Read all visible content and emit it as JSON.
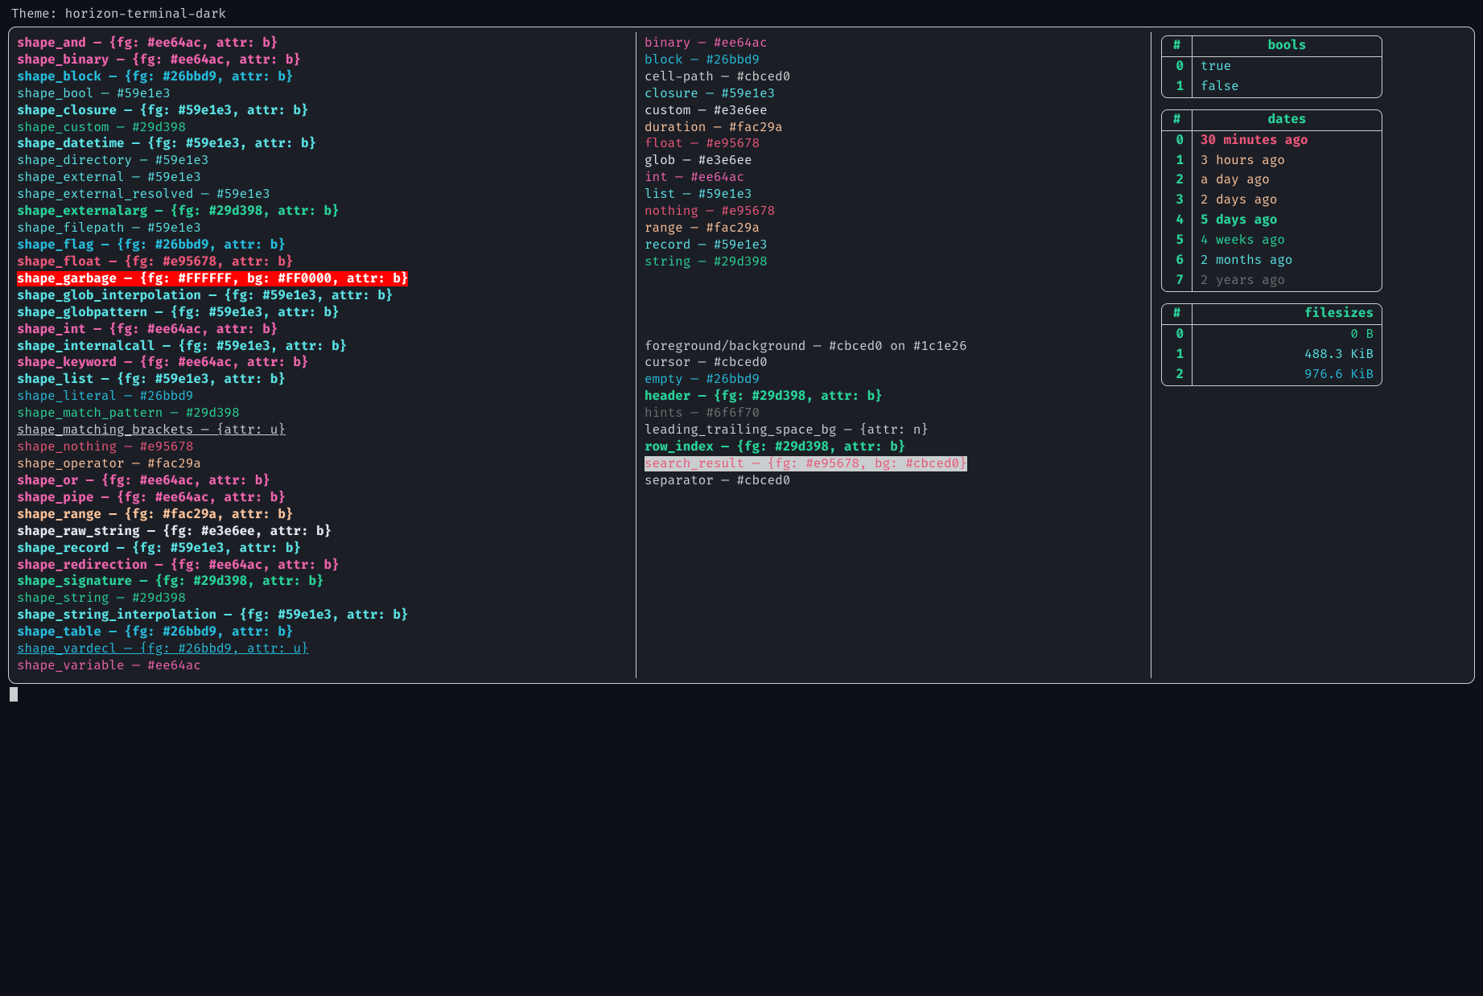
{
  "title_prefix": "Theme: ",
  "theme_name": "horizon-terminal-dark",
  "sep": " — ",
  "shapes": [
    {
      "name": "shape_and",
      "val": "{fg: #ee64ac, attr: b}",
      "fg": "#ee64ac",
      "bold": true
    },
    {
      "name": "shape_binary",
      "val": "{fg: #ee64ac, attr: b}",
      "fg": "#ee64ac",
      "bold": true
    },
    {
      "name": "shape_block",
      "val": "{fg: #26bbd9, attr: b}",
      "fg": "#26bbd9",
      "bold": true
    },
    {
      "name": "shape_bool",
      "val": "#59e1e3",
      "fg": "#59e1e3"
    },
    {
      "name": "shape_closure",
      "val": "{fg: #59e1e3, attr: b}",
      "fg": "#59e1e3",
      "bold": true
    },
    {
      "name": "shape_custom",
      "val": "#29d398",
      "fg": "#29d398"
    },
    {
      "name": "shape_datetime",
      "val": "{fg: #59e1e3, attr: b}",
      "fg": "#59e1e3",
      "bold": true
    },
    {
      "name": "shape_directory",
      "val": "#59e1e3",
      "fg": "#59e1e3"
    },
    {
      "name": "shape_external",
      "val": "#59e1e3",
      "fg": "#59e1e3"
    },
    {
      "name": "shape_external_resolved",
      "val": "#59e1e3",
      "fg": "#59e1e3"
    },
    {
      "name": "shape_externalarg",
      "val": "{fg: #29d398, attr: b}",
      "fg": "#29d398",
      "bold": true
    },
    {
      "name": "shape_filepath",
      "val": "#59e1e3",
      "fg": "#59e1e3"
    },
    {
      "name": "shape_flag",
      "val": "{fg: #26bbd9, attr: b}",
      "fg": "#26bbd9",
      "bold": true
    },
    {
      "name": "shape_float",
      "val": "{fg: #e95678, attr: b}",
      "fg": "#e95678",
      "bold": true
    },
    {
      "name": "shape_garbage",
      "val": "{fg: #FFFFFF, bg: #FF0000, attr: b}",
      "fg": "#FFFFFF",
      "bg": "#FF0000",
      "bold": true
    },
    {
      "name": "shape_glob_interpolation",
      "val": "{fg: #59e1e3, attr: b}",
      "fg": "#59e1e3",
      "bold": true
    },
    {
      "name": "shape_globpattern",
      "val": "{fg: #59e1e3, attr: b}",
      "fg": "#59e1e3",
      "bold": true
    },
    {
      "name": "shape_int",
      "val": "{fg: #ee64ac, attr: b}",
      "fg": "#ee64ac",
      "bold": true
    },
    {
      "name": "shape_internalcall",
      "val": "{fg: #59e1e3, attr: b}",
      "fg": "#59e1e3",
      "bold": true
    },
    {
      "name": "shape_keyword",
      "val": "{fg: #ee64ac, attr: b}",
      "fg": "#ee64ac",
      "bold": true
    },
    {
      "name": "shape_list",
      "val": "{fg: #59e1e3, attr: b}",
      "fg": "#59e1e3",
      "bold": true
    },
    {
      "name": "shape_literal",
      "val": "#26bbd9",
      "fg": "#26bbd9"
    },
    {
      "name": "shape_match_pattern",
      "val": "#29d398",
      "fg": "#29d398"
    },
    {
      "name": "shape_matching_brackets",
      "val": "{attr: u}",
      "fg": "#cbced0",
      "underline": true
    },
    {
      "name": "shape_nothing",
      "val": "#e95678",
      "fg": "#e95678"
    },
    {
      "name": "shape_operator",
      "val": "#fac29a",
      "fg": "#fac29a"
    },
    {
      "name": "shape_or",
      "val": "{fg: #ee64ac, attr: b}",
      "fg": "#ee64ac",
      "bold": true
    },
    {
      "name": "shape_pipe",
      "val": "{fg: #ee64ac, attr: b}",
      "fg": "#ee64ac",
      "bold": true
    },
    {
      "name": "shape_range",
      "val": "{fg: #fac29a, attr: b}",
      "fg": "#fac29a",
      "bold": true
    },
    {
      "name": "shape_raw_string",
      "val": "{fg: #e3e6ee, attr: b}",
      "fg": "#e3e6ee",
      "bold": true
    },
    {
      "name": "shape_record",
      "val": "{fg: #59e1e3, attr: b}",
      "fg": "#59e1e3",
      "bold": true
    },
    {
      "name": "shape_redirection",
      "val": "{fg: #ee64ac, attr: b}",
      "fg": "#ee64ac",
      "bold": true
    },
    {
      "name": "shape_signature",
      "val": "{fg: #29d398, attr: b}",
      "fg": "#29d398",
      "bold": true
    },
    {
      "name": "shape_string",
      "val": "#29d398",
      "fg": "#29d398"
    },
    {
      "name": "shape_string_interpolation",
      "val": "{fg: #59e1e3, attr: b}",
      "fg": "#59e1e3",
      "bold": true
    },
    {
      "name": "shape_table",
      "val": "{fg: #26bbd9, attr: b}",
      "fg": "#26bbd9",
      "bold": true
    },
    {
      "name": "shape_vardecl",
      "val": "{fg: #26bbd9, attr: u}",
      "fg": "#26bbd9",
      "underline": true
    },
    {
      "name": "shape_variable",
      "val": "#ee64ac",
      "fg": "#ee64ac"
    }
  ],
  "types": [
    {
      "name": "binary",
      "val": "#ee64ac",
      "fg": "#ee64ac"
    },
    {
      "name": "block",
      "val": "#26bbd9",
      "fg": "#26bbd9"
    },
    {
      "name": "cell-path",
      "val": "#cbced0",
      "fg": "#cbced0"
    },
    {
      "name": "closure",
      "val": "#59e1e3",
      "fg": "#59e1e3"
    },
    {
      "name": "custom",
      "val": "#e3e6ee",
      "fg": "#e3e6ee"
    },
    {
      "name": "duration",
      "val": "#fac29a",
      "fg": "#fac29a"
    },
    {
      "name": "float",
      "val": "#e95678",
      "fg": "#e95678"
    },
    {
      "name": "glob",
      "val": "#e3e6ee",
      "fg": "#e3e6ee"
    },
    {
      "name": "int",
      "val": "#ee64ac",
      "fg": "#ee64ac"
    },
    {
      "name": "list",
      "val": "#59e1e3",
      "fg": "#59e1e3"
    },
    {
      "name": "nothing",
      "val": "#e95678",
      "fg": "#e95678"
    },
    {
      "name": "range",
      "val": "#fac29a",
      "fg": "#fac29a"
    },
    {
      "name": "record",
      "val": "#59e1e3",
      "fg": "#59e1e3"
    },
    {
      "name": "string",
      "val": "#29d398",
      "fg": "#29d398"
    }
  ],
  "misc": [
    {
      "name": "foreground/background",
      "val": "#cbced0 on #1c1e26",
      "fg": "#cbced0"
    },
    {
      "name": "cursor",
      "val": "#cbced0",
      "fg": "#cbced0"
    },
    {
      "name": "empty",
      "val": "#26bbd9",
      "fg": "#26bbd9"
    },
    {
      "name": "header",
      "val": "{fg: #29d398, attr: b}",
      "fg": "#29d398",
      "bold": true
    },
    {
      "name": "hints",
      "val": "#6f6f70",
      "fg": "#6f6f70"
    },
    {
      "name": "leading_trailing_space_bg",
      "val": "{attr: n}",
      "fg": "#cbced0"
    },
    {
      "name": "row_index",
      "val": "{fg: #29d398, attr: b}",
      "fg": "#29d398",
      "bold": true
    },
    {
      "name": "search_result",
      "val": "{fg: #e95678, bg: #cbced0}",
      "fg": "#e95678",
      "bg": "#cbced0"
    },
    {
      "name": "separator",
      "val": "#cbced0",
      "fg": "#cbced0"
    }
  ],
  "tables": {
    "bools": {
      "header": "bools",
      "idx_header": "#",
      "rows": [
        {
          "i": "0",
          "v": "true",
          "fg": "#59e1e3"
        },
        {
          "i": "1",
          "v": "false",
          "fg": "#59e1e3"
        }
      ]
    },
    "dates": {
      "header": "dates",
      "idx_header": "#",
      "rows": [
        {
          "i": "0",
          "v": "30 minutes ago",
          "fg": "#e95678",
          "bold": true
        },
        {
          "i": "1",
          "v": "3 hours ago",
          "fg": "#fac29a"
        },
        {
          "i": "2",
          "v": "a day ago",
          "fg": "#fac29a"
        },
        {
          "i": "3",
          "v": "2 days ago",
          "fg": "#fac29a"
        },
        {
          "i": "4",
          "v": "5 days ago",
          "fg": "#29d398",
          "bold": true
        },
        {
          "i": "5",
          "v": "4 weeks ago",
          "fg": "#29d398"
        },
        {
          "i": "6",
          "v": "2 months ago",
          "fg": "#59e1e3"
        },
        {
          "i": "7",
          "v": "2 years ago",
          "fg": "#6f6f70"
        }
      ]
    },
    "filesizes": {
      "header": "filesizes",
      "idx_header": "#",
      "rows": [
        {
          "i": "0",
          "v": "0 B",
          "fg": "#29d398"
        },
        {
          "i": "1",
          "v": "488.3 KiB",
          "fg": "#59e1e3"
        },
        {
          "i": "2",
          "v": "976.6 KiB",
          "fg": "#26bbd9"
        }
      ]
    }
  }
}
